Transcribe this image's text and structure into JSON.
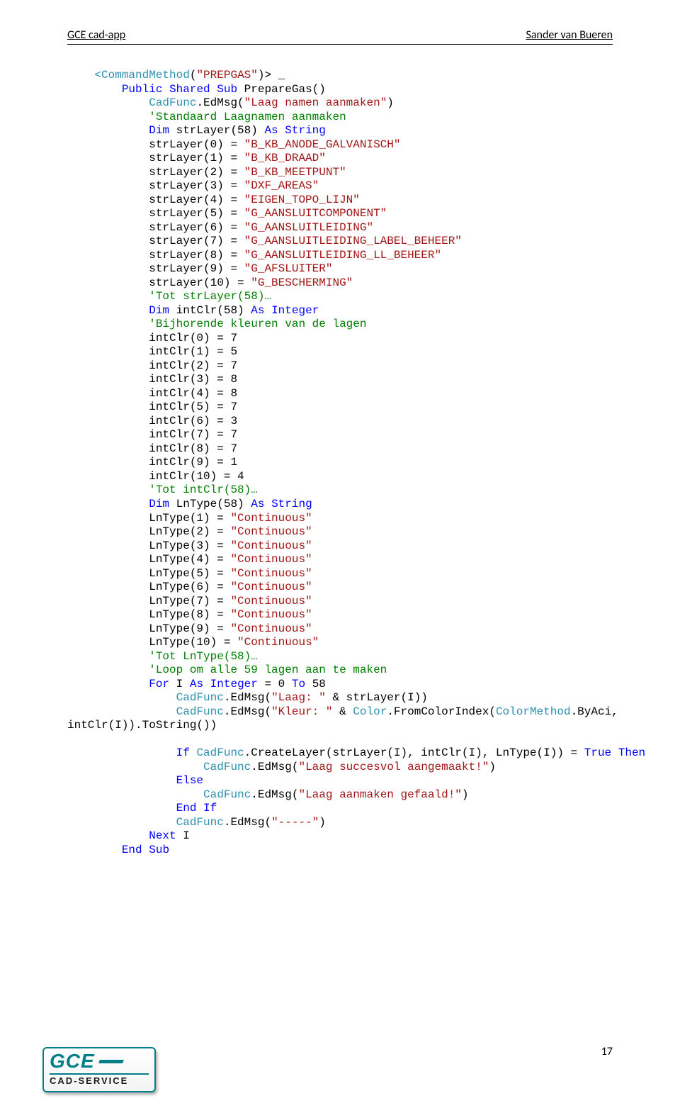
{
  "header": {
    "left": "GCE cad-app",
    "right": "Sander van Bueren"
  },
  "page_number": "17",
  "logo": {
    "line1": "GCE",
    "line2": "CAD-SERVICE"
  },
  "code": {
    "attr_open": "<",
    "attr_name": "CommandMethod",
    "attr_paren_open": "(",
    "attr_arg": "\"PREPGAS\"",
    "attr_paren_close": ")> _",
    "sig_indent": "        ",
    "kw_public": "Public",
    "kw_shared": "Shared",
    "kw_sub": "Sub",
    "sub_name": " PrepareGas()",
    "body_indent": "            ",
    "cadfunc": "CadFunc",
    "edmsg": ".EdMsg(",
    "str_laag_aanmaken": "\"Laag namen aanmaken\"",
    "close_paren": ")",
    "cmt_standaard": "'Standaard Laagnamen aanmaken",
    "kw_dim": "Dim",
    "strlayer_decl": " strLayer(58) ",
    "kw_as": "As",
    "kw_string": "String",
    "strlayer_lines": [
      {
        "pre": "strLayer(0) = ",
        "val": "\"B_KB_ANODE_GALVANISCH\""
      },
      {
        "pre": "strLayer(1) = ",
        "val": "\"B_KB_DRAAD\""
      },
      {
        "pre": "strLayer(2) = ",
        "val": "\"B_KB_MEETPUNT\""
      },
      {
        "pre": "strLayer(3) = ",
        "val": "\"DXF_AREAS\""
      },
      {
        "pre": "strLayer(4) = ",
        "val": "\"EIGEN_TOPO_LIJN\""
      },
      {
        "pre": "strLayer(5) = ",
        "val": "\"G_AANSLUITCOMPONENT\""
      },
      {
        "pre": "strLayer(6) = ",
        "val": "\"G_AANSLUITLEIDING\""
      },
      {
        "pre": "strLayer(7) = ",
        "val": "\"G_AANSLUITLEIDING_LABEL_BEHEER\""
      },
      {
        "pre": "strLayer(8) = ",
        "val": "\"G_AANSLUITLEIDING_LL_BEHEER\""
      },
      {
        "pre": "strLayer(9) = ",
        "val": "\"G_AFSLUITER\""
      },
      {
        "pre": "strLayer(10) = ",
        "val": "\"G_BESCHERMING\""
      }
    ],
    "cmt_tot_strlayer": "'Tot strLayer(58)…",
    "intclr_decl": " intClr(58) ",
    "kw_integer": "Integer",
    "cmt_bijhorende": "'Bijhorende kleuren van de lagen",
    "intclr_lines": [
      "intClr(0) = 7",
      "intClr(1) = 5",
      "intClr(2) = 7",
      "intClr(3) = 8",
      "intClr(4) = 8",
      "intClr(5) = 7",
      "intClr(6) = 3",
      "intClr(7) = 7",
      "intClr(8) = 7",
      "intClr(9) = 1",
      "intClr(10) = 4"
    ],
    "cmt_tot_intclr": "'Tot intClr(58)…",
    "lntype_decl": " LnType(58) ",
    "lntype_lines": [
      {
        "pre": "LnType(1) = ",
        "val": "\"Continuous\""
      },
      {
        "pre": "LnType(2) = ",
        "val": "\"Continuous\""
      },
      {
        "pre": "LnType(3) = ",
        "val": "\"Continuous\""
      },
      {
        "pre": "LnType(4) = ",
        "val": "\"Continuous\""
      },
      {
        "pre": "LnType(5) = ",
        "val": "\"Continuous\""
      },
      {
        "pre": "LnType(6) = ",
        "val": "\"Continuous\""
      },
      {
        "pre": "LnType(7) = ",
        "val": "\"Continuous\""
      },
      {
        "pre": "LnType(8) = ",
        "val": "\"Continuous\""
      },
      {
        "pre": "LnType(9) = ",
        "val": "\"Continuous\""
      },
      {
        "pre": "LnType(10) = ",
        "val": "\"Continuous\""
      }
    ],
    "cmt_tot_lntype": "'Tot LnType(58)…",
    "cmt_loop": "'Loop om alle 59 lagen aan te maken",
    "kw_for": "For",
    "for_body": " I ",
    "for_body2": " = 0 ",
    "kw_to": "To",
    "for_end": " 58",
    "inner_indent": "                ",
    "str_laag": "\"Laag: \"",
    "amp_strlayer": " & strLayer(I))",
    "str_kleur": "\"Kleur: \"",
    "amp": " & ",
    "color_cls": "Color",
    "from_color": ".FromColorIndex(",
    "colormethod": "ColorMethod",
    "byaci": ".ByAci, ",
    "wrap_line": "intClr(I)).ToString())",
    "blank": "",
    "kw_if": "If",
    "createlayer": ".CreateLayer(strLayer(I), intClr(I), LnType(I)) = ",
    "kw_true": "True",
    "kw_then": "Then",
    "deeper_indent": "                    ",
    "str_succes": "\"Laag succesvol aangemaakt!\"",
    "kw_else": "Else",
    "str_fail": "\"Laag aanmaken gefaald!\"",
    "kw_end": "End",
    "str_dashes": "\"-----\"",
    "kw_next": "Next",
    "next_var": " I",
    "end_sub_indent": "        "
  }
}
